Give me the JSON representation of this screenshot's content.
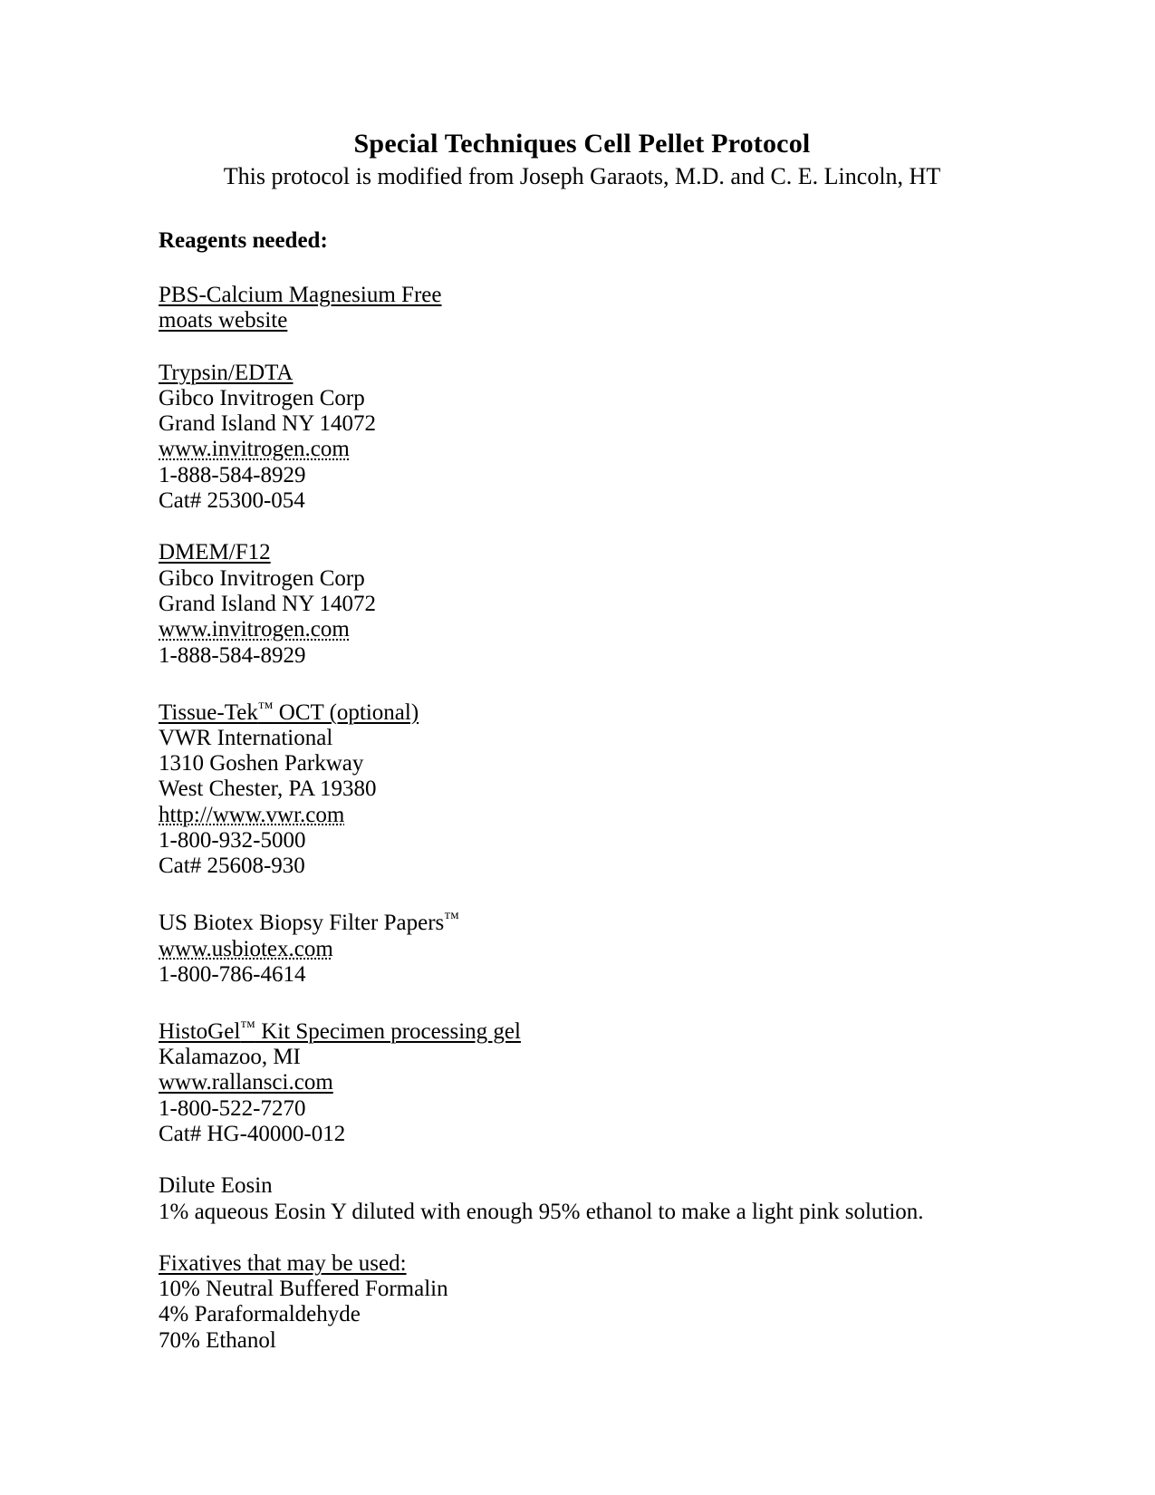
{
  "document": {
    "title": "Special Techniques Cell Pellet Protocol",
    "subtitle": "This protocol is modified from Joseph Garaots, M.D. and C. E. Lincoln, HT",
    "reagents_heading": "Reagents needed:",
    "reagents": [
      {
        "name": "PBS-Calcium Magnesium Free",
        "name_style": "underline",
        "lines": [
          {
            "text": "moats website",
            "style": "underline"
          }
        ]
      },
      {
        "name": "Trypsin/EDTA",
        "name_style": "underline",
        "lines": [
          {
            "text": "Gibco Invitrogen Corp",
            "style": "plain"
          },
          {
            "text": "Grand Island NY 14072",
            "style": "plain"
          },
          {
            "text": "www.invitrogen.com",
            "style": "dotted-underline"
          },
          {
            "text": "1-888-584-8929",
            "style": "plain"
          },
          {
            "text": "Cat# 25300-054",
            "style": "plain"
          }
        ]
      },
      {
        "name": "DMEM/F12",
        "name_style": "underline",
        "lines": [
          {
            "text": "Gibco Invitrogen Corp",
            "style": "plain"
          },
          {
            "text": "Grand Island NY 14072",
            "style": "plain"
          },
          {
            "text": "www.invitrogen.com",
            "style": "dotted-underline"
          },
          {
            "text": "1-888-584-8929",
            "style": "plain"
          }
        ]
      },
      {
        "name": "Tissue-Tek™ OCT (optional)",
        "name_style": "underline",
        "lines": [
          {
            "text": "VWR International",
            "style": "plain"
          },
          {
            "text": "1310 Goshen Parkway",
            "style": "plain"
          },
          {
            "text": "West Chester, PA 19380",
            "style": "plain"
          },
          {
            "text": "http://www.vwr.com",
            "style": "dotted-underline"
          },
          {
            "text": "1-800-932-5000",
            "style": "plain"
          },
          {
            "text": "Cat# 25608-930",
            "style": "plain"
          }
        ]
      },
      {
        "name": "US Biotex Biopsy Filter Papers™",
        "name_style": "plain",
        "lines": [
          {
            "text": "www.usbiotex.com",
            "style": "dotted-underline"
          },
          {
            "text": "1-800-786-4614",
            "style": "plain"
          }
        ]
      },
      {
        "name": "HistoGel™ Kit Specimen processing gel",
        "name_style": "underline",
        "lines": [
          {
            "text": "Kalamazoo, MI",
            "style": "plain"
          },
          {
            "text": "www.rallansci.com",
            "style": "underline"
          },
          {
            "text": "1-800-522-7270",
            "style": "plain"
          },
          {
            "text": "Cat# HG-40000-012",
            "style": "plain"
          }
        ]
      },
      {
        "name": "Dilute Eosin",
        "name_style": "plain",
        "lines": [
          {
            "text": "1% aqueous Eosin Y diluted with enough 95% ethanol to make a light pink solution.",
            "style": "plain"
          }
        ]
      },
      {
        "name": "Fixatives that may be used:",
        "name_style": "underline",
        "lines": [
          {
            "text": "10% Neutral Buffered Formalin",
            "style": "plain"
          },
          {
            "text": "4% Paraformaldehyde",
            "style": "plain"
          },
          {
            "text": "70% Ethanol",
            "style": "plain"
          }
        ]
      }
    ]
  }
}
